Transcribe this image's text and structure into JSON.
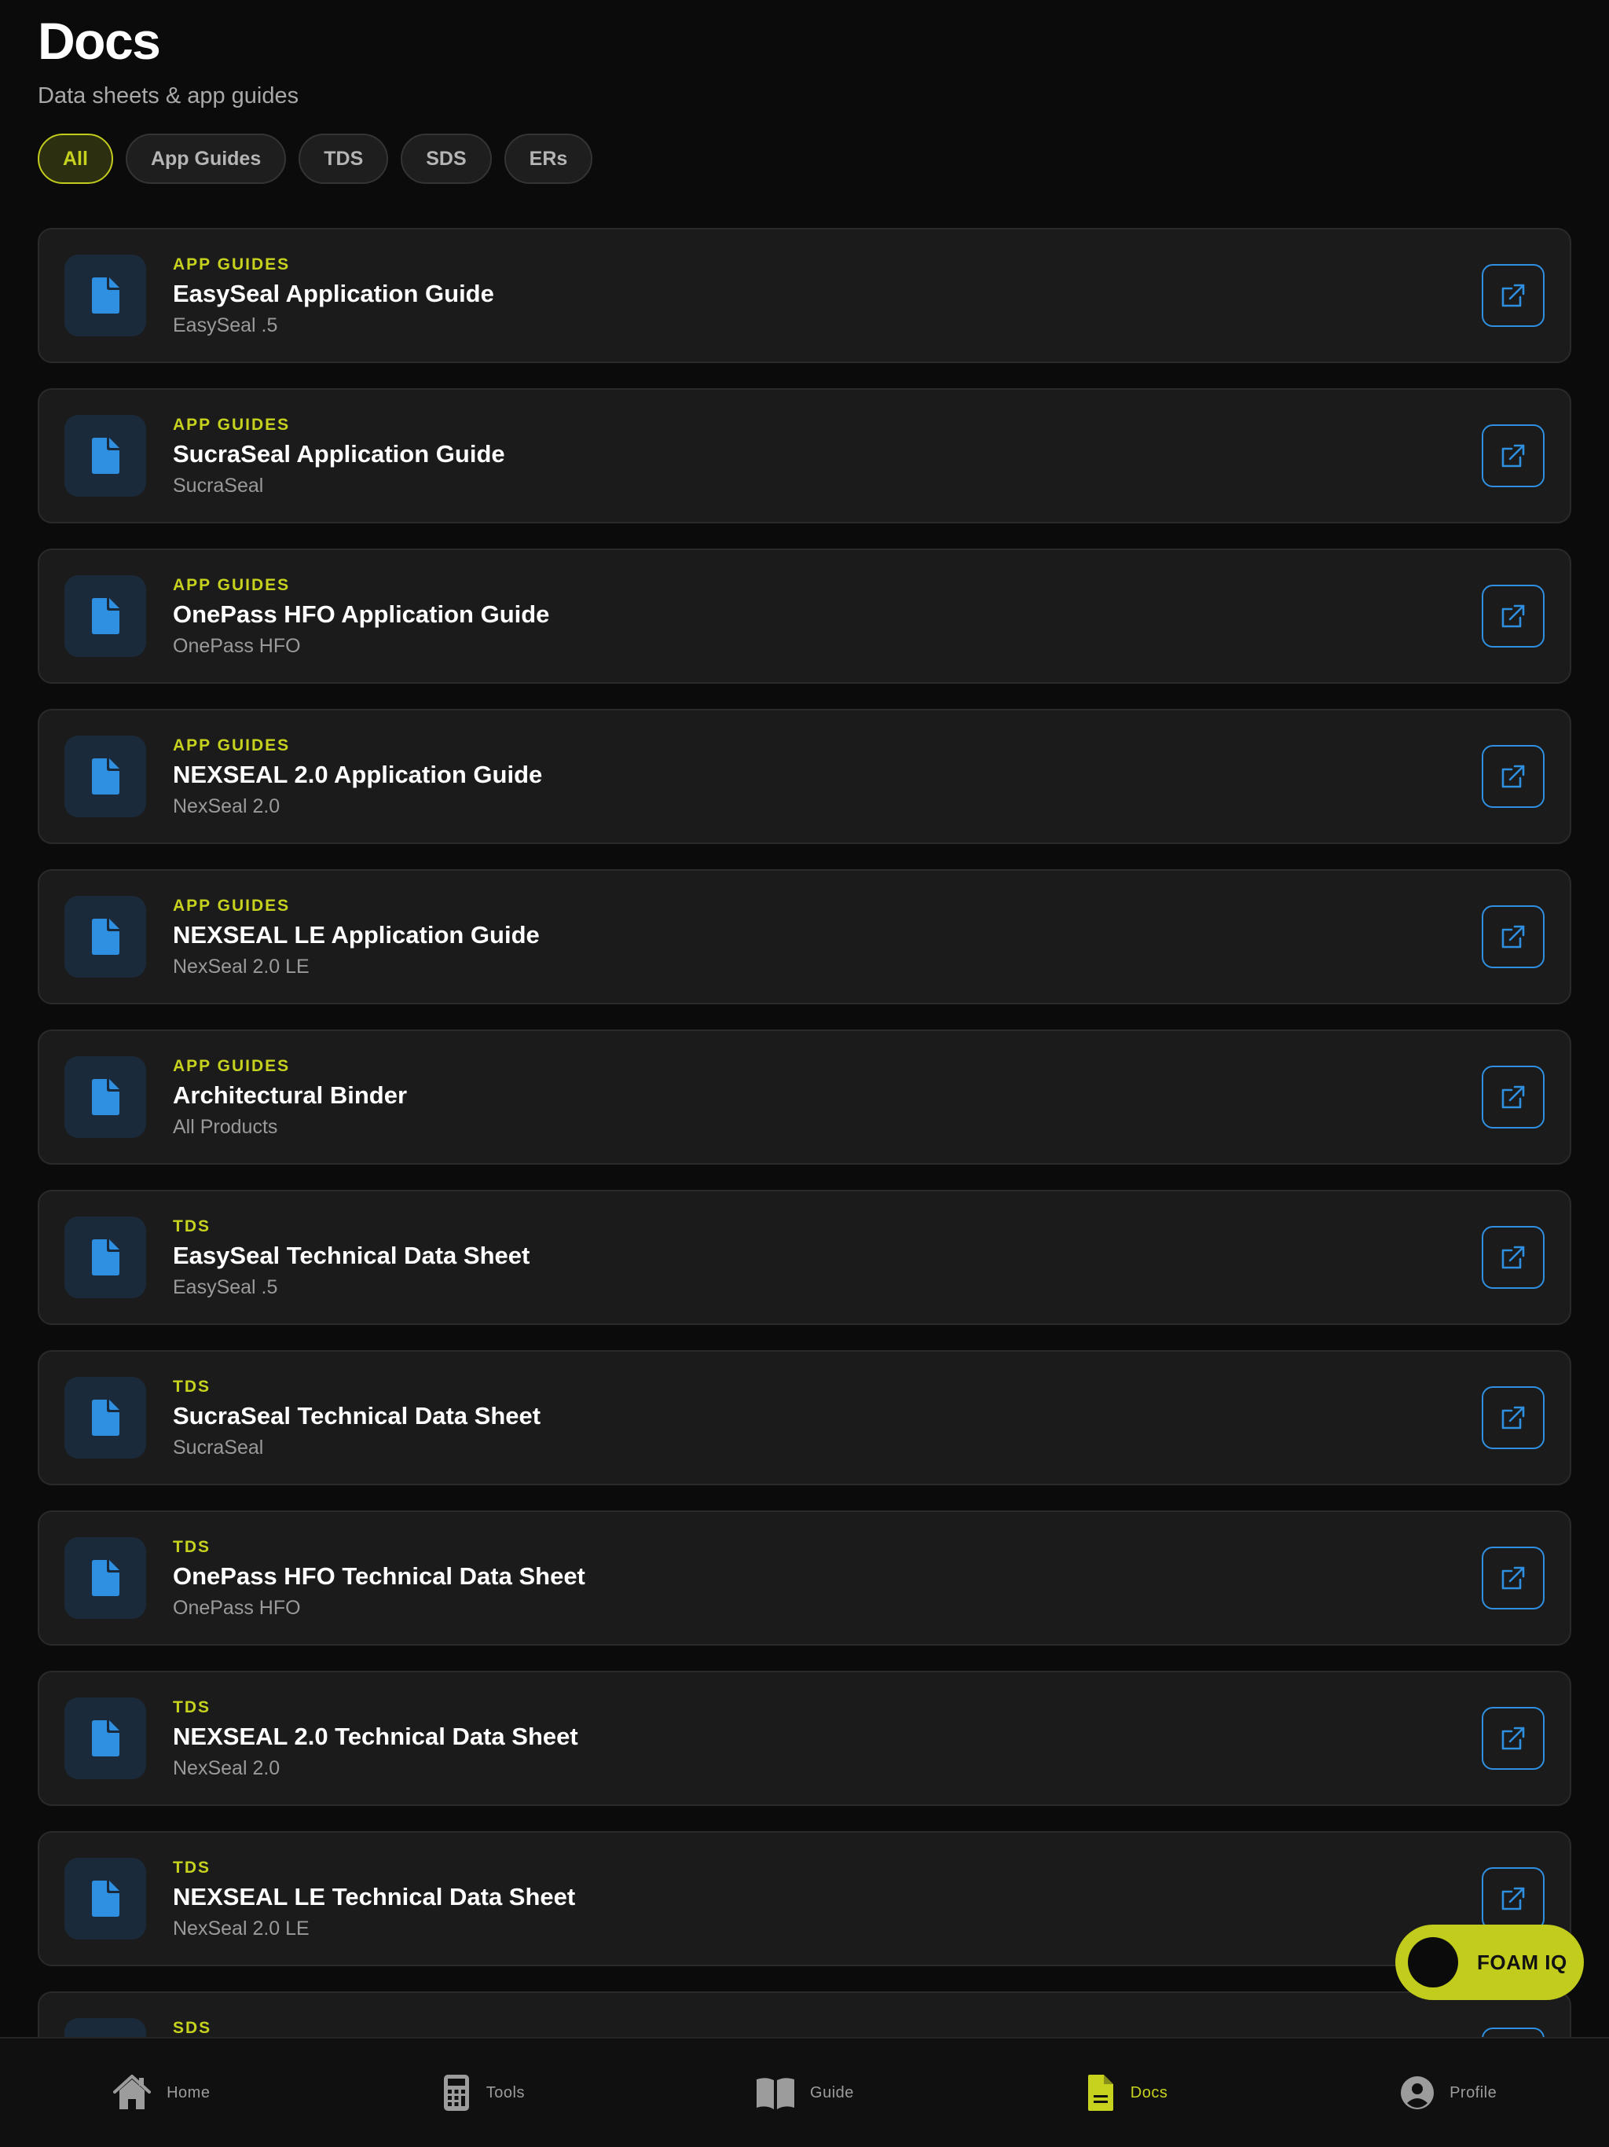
{
  "header": {
    "title": "Docs",
    "subtitle": "Data sheets & app guides"
  },
  "filters": [
    {
      "label": "All",
      "active": true
    },
    {
      "label": "App Guides",
      "active": false
    },
    {
      "label": "TDS",
      "active": false
    },
    {
      "label": "SDS",
      "active": false
    },
    {
      "label": "ERs",
      "active": false
    }
  ],
  "documents": [
    {
      "category": "APP GUIDES",
      "title": "EasySeal Application Guide",
      "product": "EasySeal .5"
    },
    {
      "category": "APP GUIDES",
      "title": "SucraSeal Application Guide",
      "product": "SucraSeal"
    },
    {
      "category": "APP GUIDES",
      "title": "OnePass HFO Application Guide",
      "product": "OnePass HFO"
    },
    {
      "category": "APP GUIDES",
      "title": "NEXSEAL 2.0 Application Guide",
      "product": "NexSeal 2.0"
    },
    {
      "category": "APP GUIDES",
      "title": "NEXSEAL LE Application Guide",
      "product": "NexSeal 2.0 LE"
    },
    {
      "category": "APP GUIDES",
      "title": "Architectural Binder",
      "product": "All Products"
    },
    {
      "category": "TDS",
      "title": "EasySeal Technical Data Sheet",
      "product": "EasySeal .5"
    },
    {
      "category": "TDS",
      "title": "SucraSeal Technical Data Sheet",
      "product": "SucraSeal"
    },
    {
      "category": "TDS",
      "title": "OnePass HFO Technical Data Sheet",
      "product": "OnePass HFO"
    },
    {
      "category": "TDS",
      "title": "NEXSEAL 2.0 Technical Data Sheet",
      "product": "NexSeal 2.0"
    },
    {
      "category": "TDS",
      "title": "NEXSEAL LE Technical Data Sheet",
      "product": "NexSeal 2.0 LE"
    },
    {
      "category": "SDS",
      "title": "",
      "product": ""
    }
  ],
  "fab": {
    "label": "FOAM IQ"
  },
  "tabs": [
    {
      "label": "Home",
      "icon": "home-icon",
      "active": false
    },
    {
      "label": "Tools",
      "icon": "calculator-icon",
      "active": false
    },
    {
      "label": "Guide",
      "icon": "book-icon",
      "active": false
    },
    {
      "label": "Docs",
      "icon": "document-icon",
      "active": true
    },
    {
      "label": "Profile",
      "icon": "profile-icon",
      "active": false
    }
  ],
  "colors": {
    "accent": "#c6d21e",
    "link_blue": "#2f8fe0",
    "background": "#0b0b0b",
    "card": "#1b1b1b"
  }
}
